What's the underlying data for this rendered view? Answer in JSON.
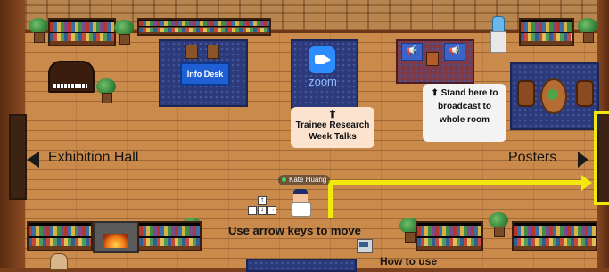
{
  "map": {
    "info_desk_label": "Info Desk",
    "zoom_label": "zoom",
    "trainee_sign": {
      "arrow": "⬆",
      "line1": "Trainee Research",
      "line2": "Week Talks"
    },
    "broadcast_sign": {
      "arrow": "⬆",
      "line1": "Stand here to",
      "line2": "broadcast to",
      "line3": "whole room"
    },
    "exhibition_label": "Exhibition Hall",
    "posters_label": "Posters",
    "player_name": "Kate Huang",
    "move_hint": "Use arrow keys to move",
    "howto_label": "How to use",
    "arrow_keys": [
      "↑",
      "←",
      "↓",
      "→"
    ],
    "banner_icon": "📢"
  },
  "colors": {
    "path_highlight": "#f3e80c",
    "zoom_blue": "#2d8cff",
    "info_desk_blue": "#1f5fd6",
    "rug_blue": "#2c3a7a"
  },
  "icons": [
    "zoom-camera-icon",
    "megaphone-icon",
    "status-online-icon"
  ]
}
